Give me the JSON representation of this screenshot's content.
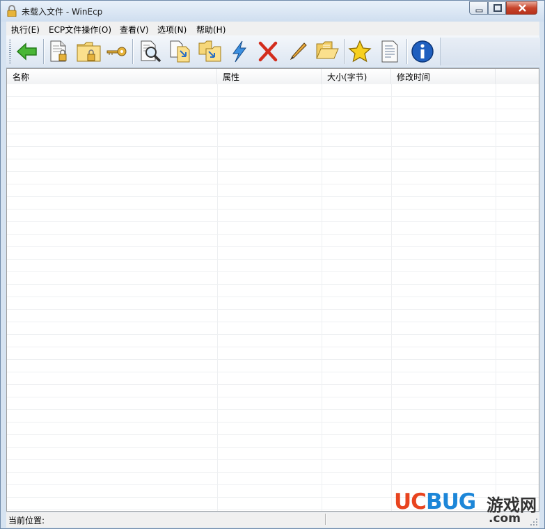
{
  "window": {
    "title": "未载入文件 - WinEcp",
    "controls": {
      "minimize": "minimize-icon",
      "maximize": "maximize-icon",
      "close": "close-icon"
    }
  },
  "menu": {
    "items": [
      "执行(E)",
      "ECP文件操作(O)",
      "查看(V)",
      "选项(N)",
      "帮助(H)"
    ]
  },
  "toolbar": {
    "buttons": [
      "back-arrow-icon",
      "lock-document-icon",
      "lock-folder-icon",
      "key-icon",
      "search-document-icon",
      "copy-document-icon",
      "move-folder-icon",
      "lightning-icon",
      "delete-icon",
      "pencil-icon",
      "open-folder-icon",
      "star-icon",
      "text-document-icon",
      "info-icon"
    ]
  },
  "list": {
    "columns": [
      "名称",
      "属性",
      "大小(字节)",
      "修改时间"
    ],
    "rows": []
  },
  "status": {
    "label": "当前位置:"
  },
  "watermark": {
    "uc": "UC",
    "bug": "BUG",
    "cn": "游戏网",
    "com": ".com"
  },
  "colors": {
    "accent_close": "#c7442b",
    "watermark_red": "#e8441f",
    "watermark_blue": "#1c86d8"
  }
}
